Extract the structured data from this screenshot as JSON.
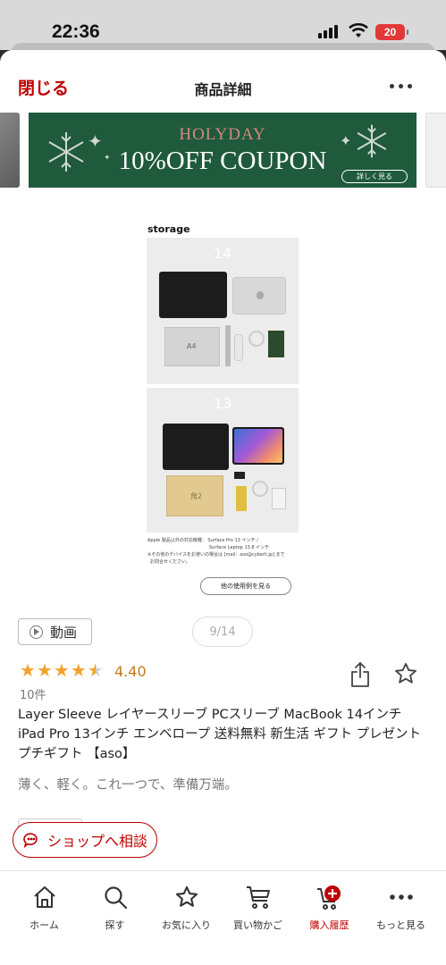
{
  "status_bar": {
    "time": "22:36",
    "battery": "20"
  },
  "header": {
    "close_label": "閉じる",
    "title": "商品詳細"
  },
  "banner": {
    "headline": "HOLYDAY",
    "coupon": "10%OFF COUPON",
    "detail_button": "詳しく見る"
  },
  "product_image": {
    "storage_label": "storage",
    "panel_top_size": "14",
    "panel_bottom_size": "13",
    "envelope_label_top": "A4",
    "envelope_label_bottom": "角2",
    "note_line1": "Apple 製品以外の対応機種： Surface Pro 13 インチ /",
    "note_line2": "Surface Laptop 13.8 インチ",
    "note_line3": "※その他のデバイスをお使いの場合は [mail：aso@cyberli.jp] まで",
    "note_line4": "お問合せください。",
    "other_examples_button": "他の使用例を見る"
  },
  "media": {
    "video_label": "動画",
    "pager": "9/14"
  },
  "rating": {
    "value": "4.40",
    "stars": 4.4,
    "review_count": "10件"
  },
  "product": {
    "title": "Layer Sleeve レイヤースリーブ PCスリーブ MacBook 14インチ iPad Pro 13インチ エンベロープ 送料無料 新生活 ギフト プレゼント プチギフト 【aso】",
    "catchcopy": "薄く、軽く。これ一つで、準備万端。"
  },
  "consult_button": "ショップへ相談",
  "tabbar": {
    "items": [
      {
        "label": "ホーム",
        "icon": "home-icon"
      },
      {
        "label": "探す",
        "icon": "search-icon"
      },
      {
        "label": "お気に入り",
        "icon": "star-icon"
      },
      {
        "label": "買い物かご",
        "icon": "cart-icon"
      },
      {
        "label": "購入履歴",
        "icon": "purchase-history-icon"
      },
      {
        "label": "もっと見る",
        "icon": "more-icon"
      }
    ]
  },
  "colors": {
    "accent": "#bf0000",
    "banner_bg": "#1f5a3c",
    "star": "#f0a22e"
  }
}
